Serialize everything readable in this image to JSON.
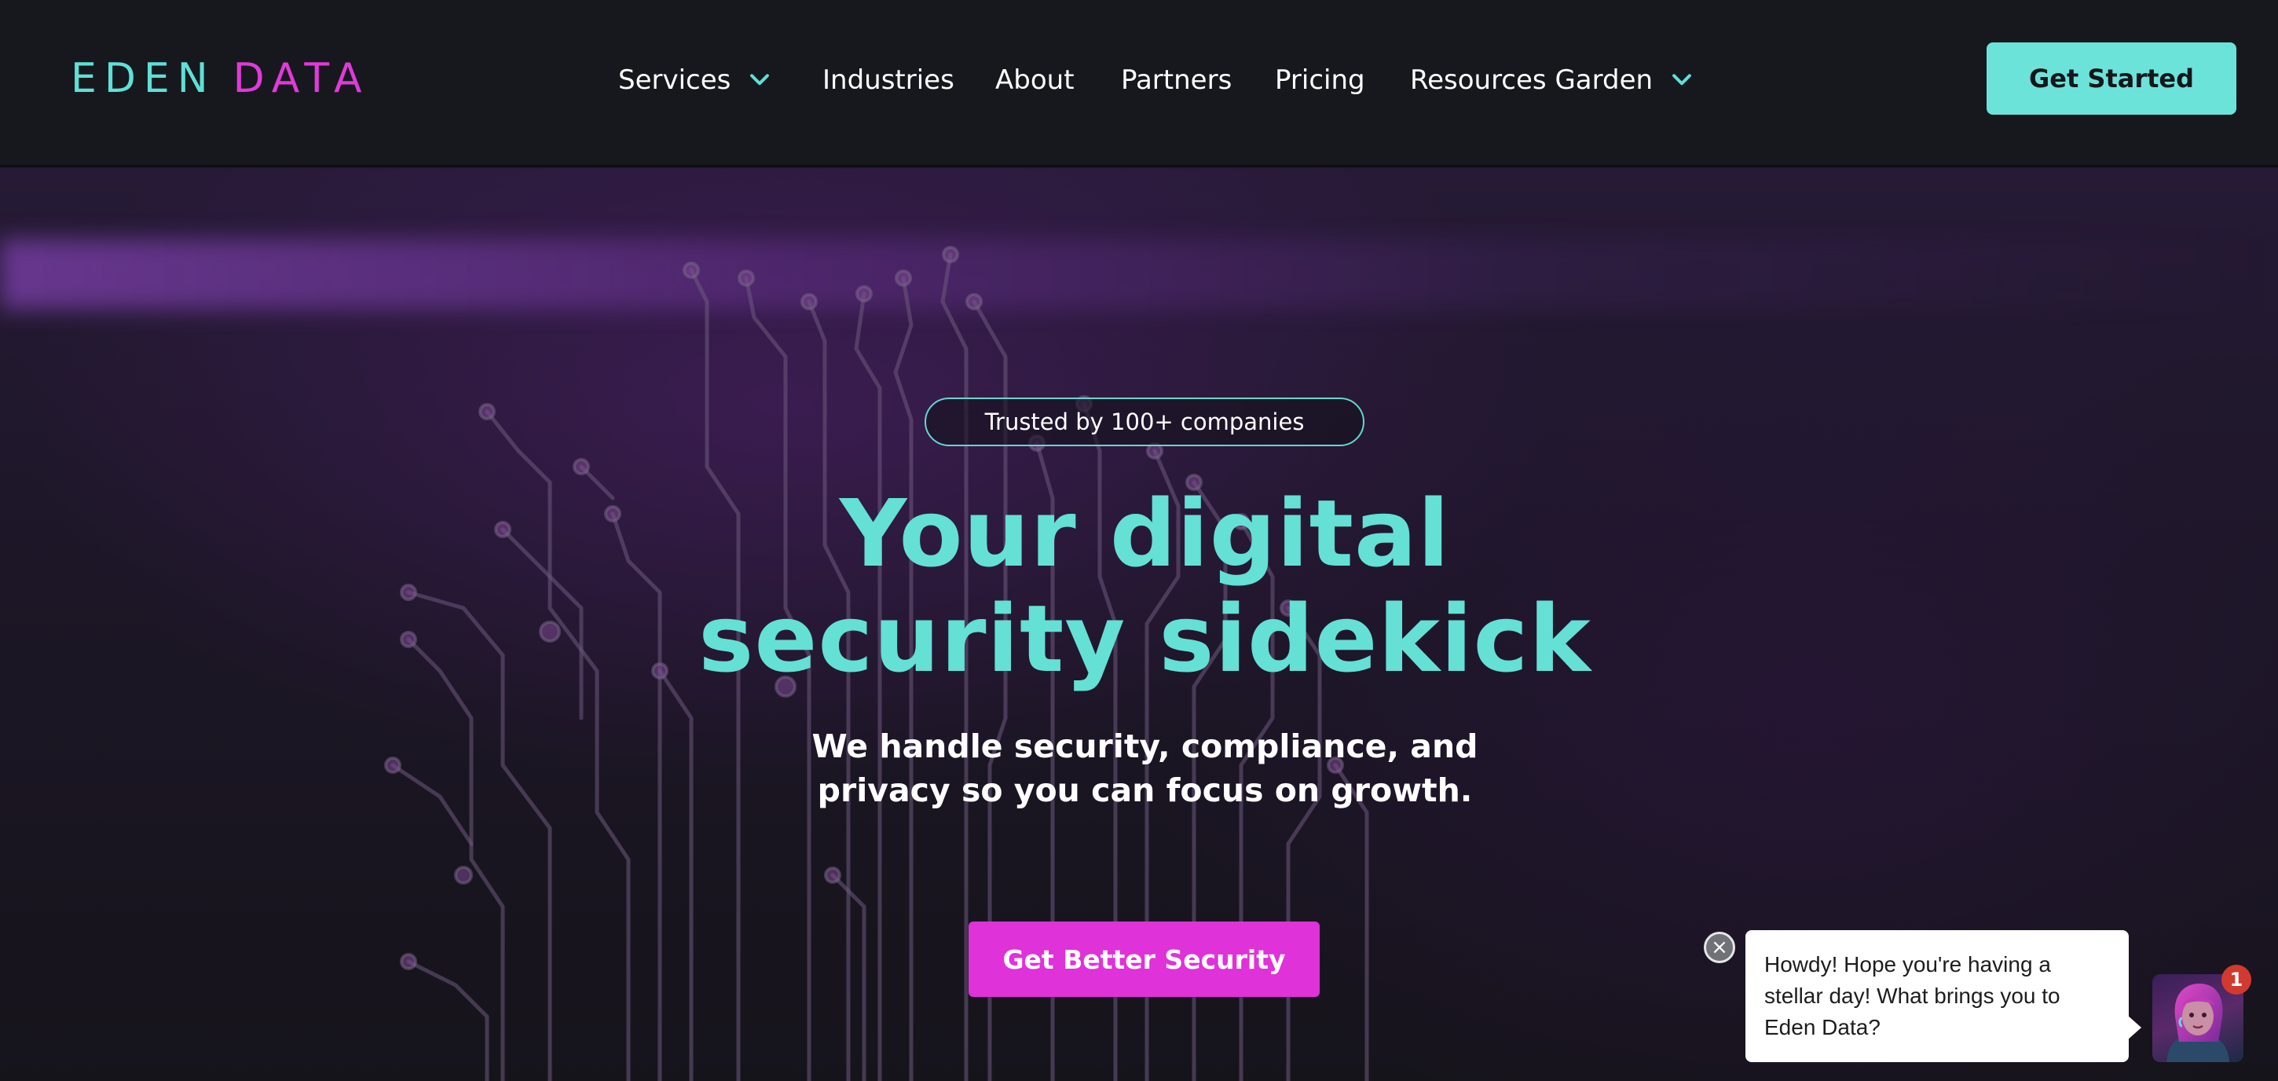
{
  "header": {
    "logo": {
      "part1": "EDEN",
      "part2": "DATA"
    },
    "nav": [
      {
        "label": "Services",
        "has_dropdown": true
      },
      {
        "label": "Industries",
        "has_dropdown": false
      },
      {
        "label": "About",
        "has_dropdown": false
      },
      {
        "label": "Partners",
        "has_dropdown": false
      },
      {
        "label": "Pricing",
        "has_dropdown": false
      },
      {
        "label": "Resources Garden",
        "has_dropdown": true
      }
    ],
    "cta_label": "Get Started"
  },
  "hero": {
    "badge": "Trusted by 100+ companies",
    "headline_line1": "Your digital",
    "headline_line2": "security sidekick",
    "subhead_line1": "We handle security, compliance, and",
    "subhead_line2": "privacy so you can focus on growth.",
    "cta_label": "Get Better Security"
  },
  "chat": {
    "close_icon": "×",
    "message": "Howdy! Hope you're having a stellar day! What brings you to Eden Data?",
    "unread_count": "1",
    "avatar_icon": "assistant-avatar"
  },
  "colors": {
    "accent_teal": "#64e0d5",
    "accent_magenta": "#df32d8",
    "header_bg": "#17181e",
    "notification_red": "#d23a2f"
  }
}
